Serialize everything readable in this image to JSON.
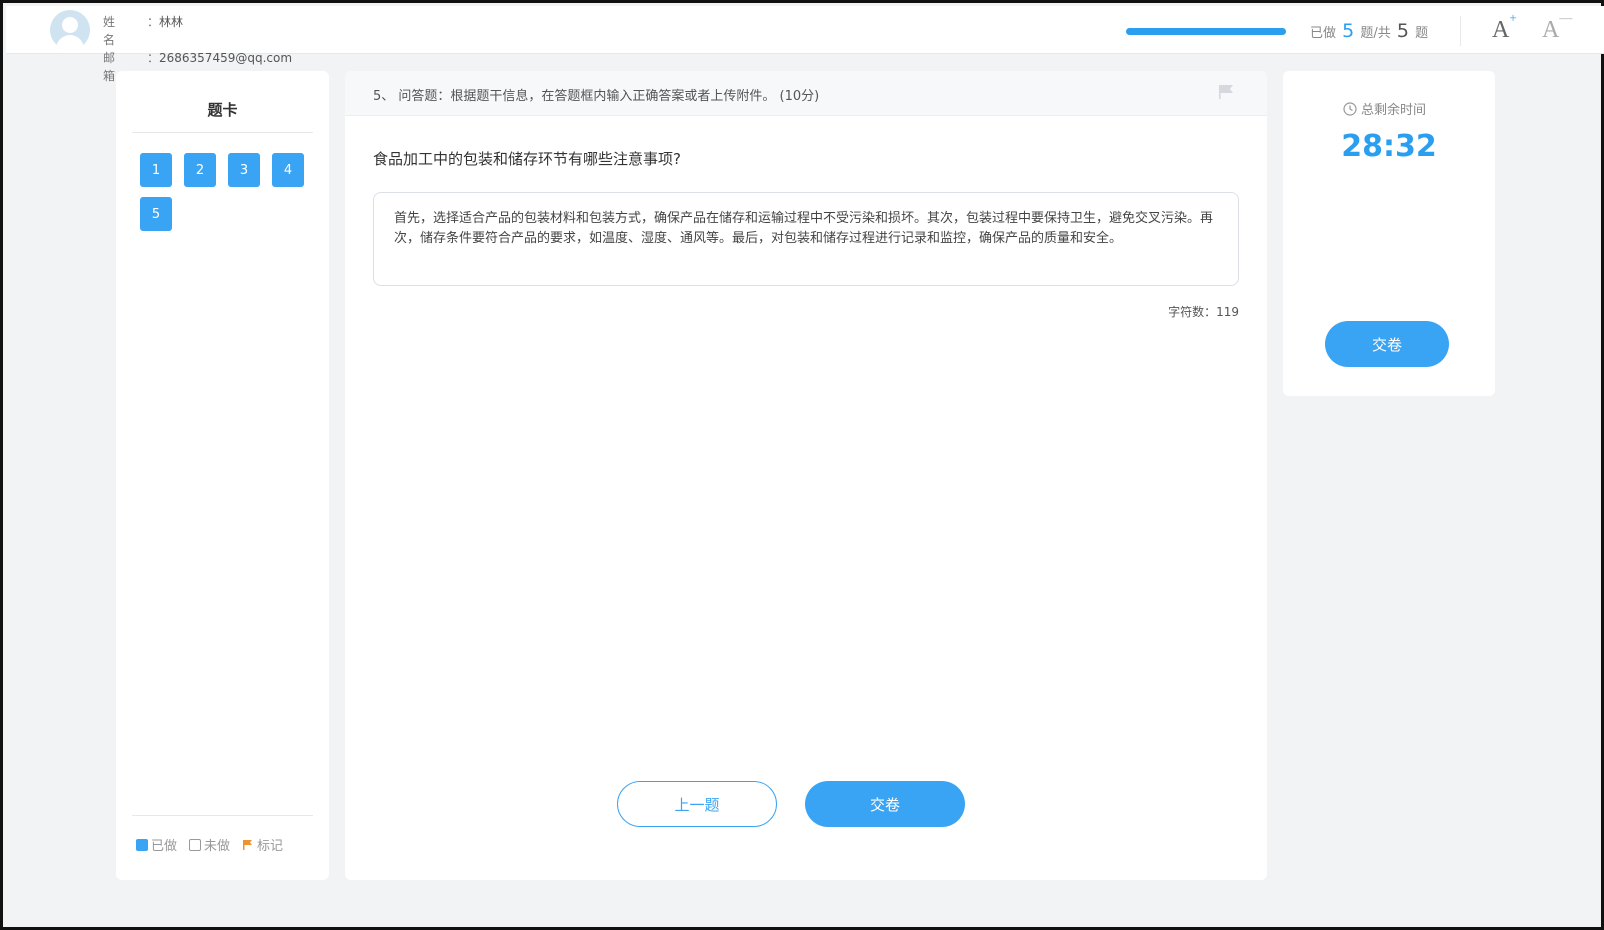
{
  "user": {
    "name_label": "姓 名",
    "name": "林林",
    "email_label": "邮 箱",
    "email": "2686357459@qq.com",
    "colon": "："
  },
  "progress": {
    "done": "5",
    "total": "5",
    "prefix": "已做",
    "middle": "题/共",
    "suffix": "题",
    "fraction": 1.0
  },
  "font_controls": {
    "increase": "A",
    "increase_mark": "+",
    "decrease": "A",
    "decrease_mark": "—"
  },
  "question_card": {
    "title": "题卡",
    "numbers": [
      "1",
      "2",
      "3",
      "4",
      "5"
    ],
    "legend": {
      "done": "已做",
      "todo": "未做",
      "marked": "标记"
    }
  },
  "question": {
    "header": "5、 问答题：根据题干信息，在答题框内输入正确答案或者上传附件。 (10分)",
    "text": "食品加工中的包装和储存环节有哪些注意事项?",
    "answer": "首先，选择适合产品的包装材料和包装方式，确保产品在储存和运输过程中不受污染和损坏。其次，包装过程中要保持卫生，避免交叉污染。再次，储存条件要符合产品的要求，如温度、湿度、通风等。最后，对包装和储存过程进行记录和监控，确保产品的质量和安全。",
    "char_count_label": "字符数：",
    "char_count": "119",
    "prev_button": "上一题",
    "submit_button": "交卷"
  },
  "timer": {
    "label": "总剩余时间",
    "value": "28:32",
    "submit_button": "交卷"
  },
  "colors": {
    "accent": "#3aa4f4",
    "background": "#f2f3f5"
  }
}
